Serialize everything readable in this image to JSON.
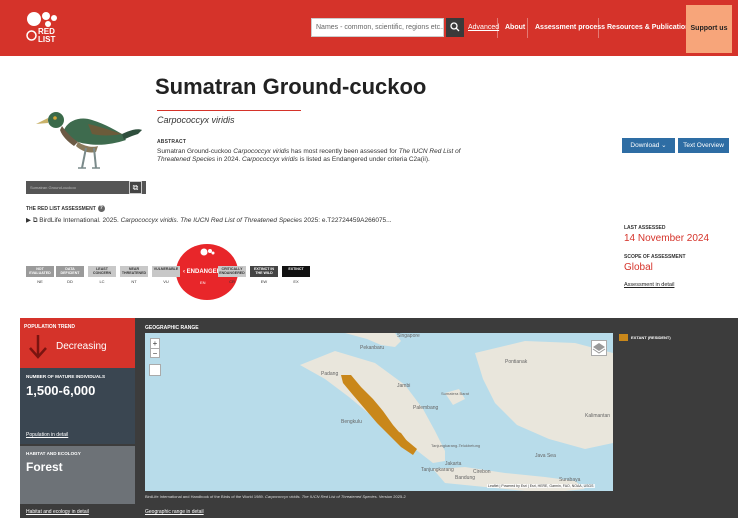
{
  "header": {
    "logo_text": "RED\nLIST",
    "search_placeholder": "Names - common, scientific, regions etc...",
    "advanced_label": "Advanced",
    "nav": [
      "About",
      "Assessment process",
      "Resources & Publications",
      "Support us"
    ]
  },
  "species": {
    "common_name": "Sumatran Ground-cuckoo",
    "scientific_name": "Carpococcyx viridis",
    "abstract_label": "ABSTRACT",
    "abstract_text_1": "Sumatran Ground-cuckoo ",
    "abstract_text_2": "Carpococcyx viridis",
    "abstract_text_3": " has most recently been assessed for ",
    "abstract_text_4": "The IUCN Red List of Threatened Species",
    "abstract_text_5": " in 2024. ",
    "abstract_text_6": "Carpococcyx viridis",
    "abstract_text_7": " is listed as Endangered under criteria C2a(ii).",
    "download_label": "Download",
    "text_overview_label": "Text Overview",
    "image_caption": "Sumatran Ground-cuckoo"
  },
  "assessment": {
    "section_label": "THE RED LIST ASSESSMENT",
    "citation_1": "BirdLife International. 2025. ",
    "citation_2": "Carpococcyx viridis. The IUCN Red List of Threatened Species",
    "citation_3": " 2025: e.T22724459A266075...",
    "last_assessed_label": "LAST ASSESSED",
    "last_assessed_value": "14 November 2024",
    "scope_label": "SCOPE OF ASSESSMENT",
    "scope_value": "Global",
    "detail_link": "Assessment in detail"
  },
  "scale": {
    "categories": [
      {
        "label": "NOT EVALUATED",
        "abbr": "NE"
      },
      {
        "label": "DATA DEFICIENT",
        "abbr": "DD"
      },
      {
        "label": "LEAST CONCERN",
        "abbr": "LC"
      },
      {
        "label": "NEAR THREATENED",
        "abbr": "NT"
      },
      {
        "label": "VULNERABLE",
        "abbr": "VU"
      },
      {
        "label": "ENDANGERED",
        "abbr": "EN"
      },
      {
        "label": "CRITICALLY ENDANGERED",
        "abbr": "CR"
      },
      {
        "label": "EXTINCT IN THE WILD",
        "abbr": "EW"
      },
      {
        "label": "EXTINCT",
        "abbr": "EX"
      }
    ],
    "current": "ENDANGERED",
    "current_abbr": "EN"
  },
  "panel": {
    "trend_label": "POPULATION TREND",
    "trend_value": "Decreasing",
    "mature_label": "NUMBER OF MATURE INDIVIDUALS",
    "mature_value": "1,500-6,000",
    "population_link": "Population in detail",
    "habitat_label": "HABITAT AND ECOLOGY",
    "habitat_value": "Forest",
    "habitat_link": "Habitat and ecology in detail",
    "geo_label": "GEOGRAPHIC RANGE",
    "geo_link": "Geographic range in detail",
    "legend_label": "EXTANT (RESIDENT)",
    "map_caption_1": "BirdLife International and Handbook of the Birds of the World 1989. ",
    "map_caption_2": "Carpococcyx viridis. The IUCN Red List of Threatened Species.",
    "map_caption_3": " Version 2025-2",
    "attribution": "Leaflet | Powered by Esri | Esri, HERE, Garmin, FAO, NOAA, USGS",
    "zoom_in": "+",
    "zoom_out": "−",
    "map_labels": [
      "Singapore",
      "Pekanbaru",
      "Padang",
      "Jambi",
      "Palembang",
      "Bengkulu",
      "Tanjungkarang-Telukbetung",
      "Jakarta",
      "Tanjungkarang",
      "Cirebon",
      "Bandung",
      "Surabaya",
      "Pontianak",
      "Java Sea",
      "Kalimantan",
      "Sumatera Barat"
    ],
    "colors": {
      "trend": "#d5332a",
      "range": "#c9871a",
      "endangered": "#e8262a"
    }
  }
}
